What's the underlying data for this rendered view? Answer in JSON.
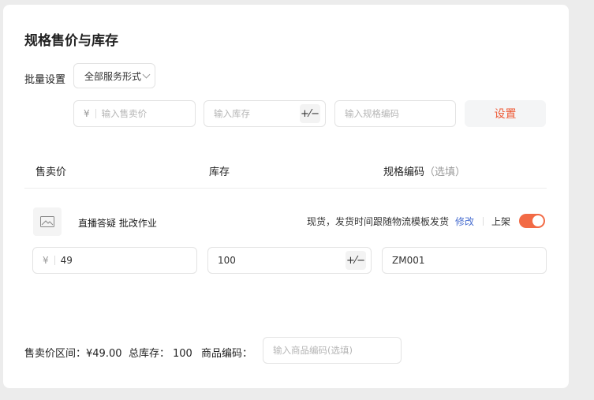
{
  "title": "规格售价与库存",
  "batch": {
    "label": "批量设置",
    "service_select": "全部服务形式",
    "price_currency": "¥",
    "price_placeholder": "输入售卖价",
    "stock_placeholder": "输入库存",
    "stock_toggle_glyph": "+⁄−",
    "sku_code_placeholder": "输入规格编码",
    "set_button": "设置"
  },
  "table": {
    "headers": {
      "price": "售卖价",
      "stock": "库存",
      "sku_code": "规格编码",
      "sku_code_optional": "（选填）"
    },
    "rows": [
      {
        "name": "直播答疑 批改作业",
        "shipping": "现货，发货时间跟随物流模板发货",
        "edit_label": "修改",
        "listed_label": "上架",
        "listed": true,
        "currency": "¥",
        "price": "49",
        "stock": "100",
        "sku_code": "ZM001"
      }
    ]
  },
  "footer": {
    "price_range_label": "售卖价区间：",
    "price_range_value": "¥49.00",
    "total_stock_label": "总库存：",
    "total_stock_value": "100",
    "product_code_label": "商品编码：",
    "product_code_placeholder": "输入商品编码(选填)"
  },
  "colors": {
    "accent": "#ee5b37",
    "toggle_on": "#f26a45",
    "link": "#4a6fd0",
    "page_bg": "#ececec"
  },
  "icons": {
    "thumbnail": "image-placeholder-icon",
    "select": "chevron-down-icon"
  }
}
